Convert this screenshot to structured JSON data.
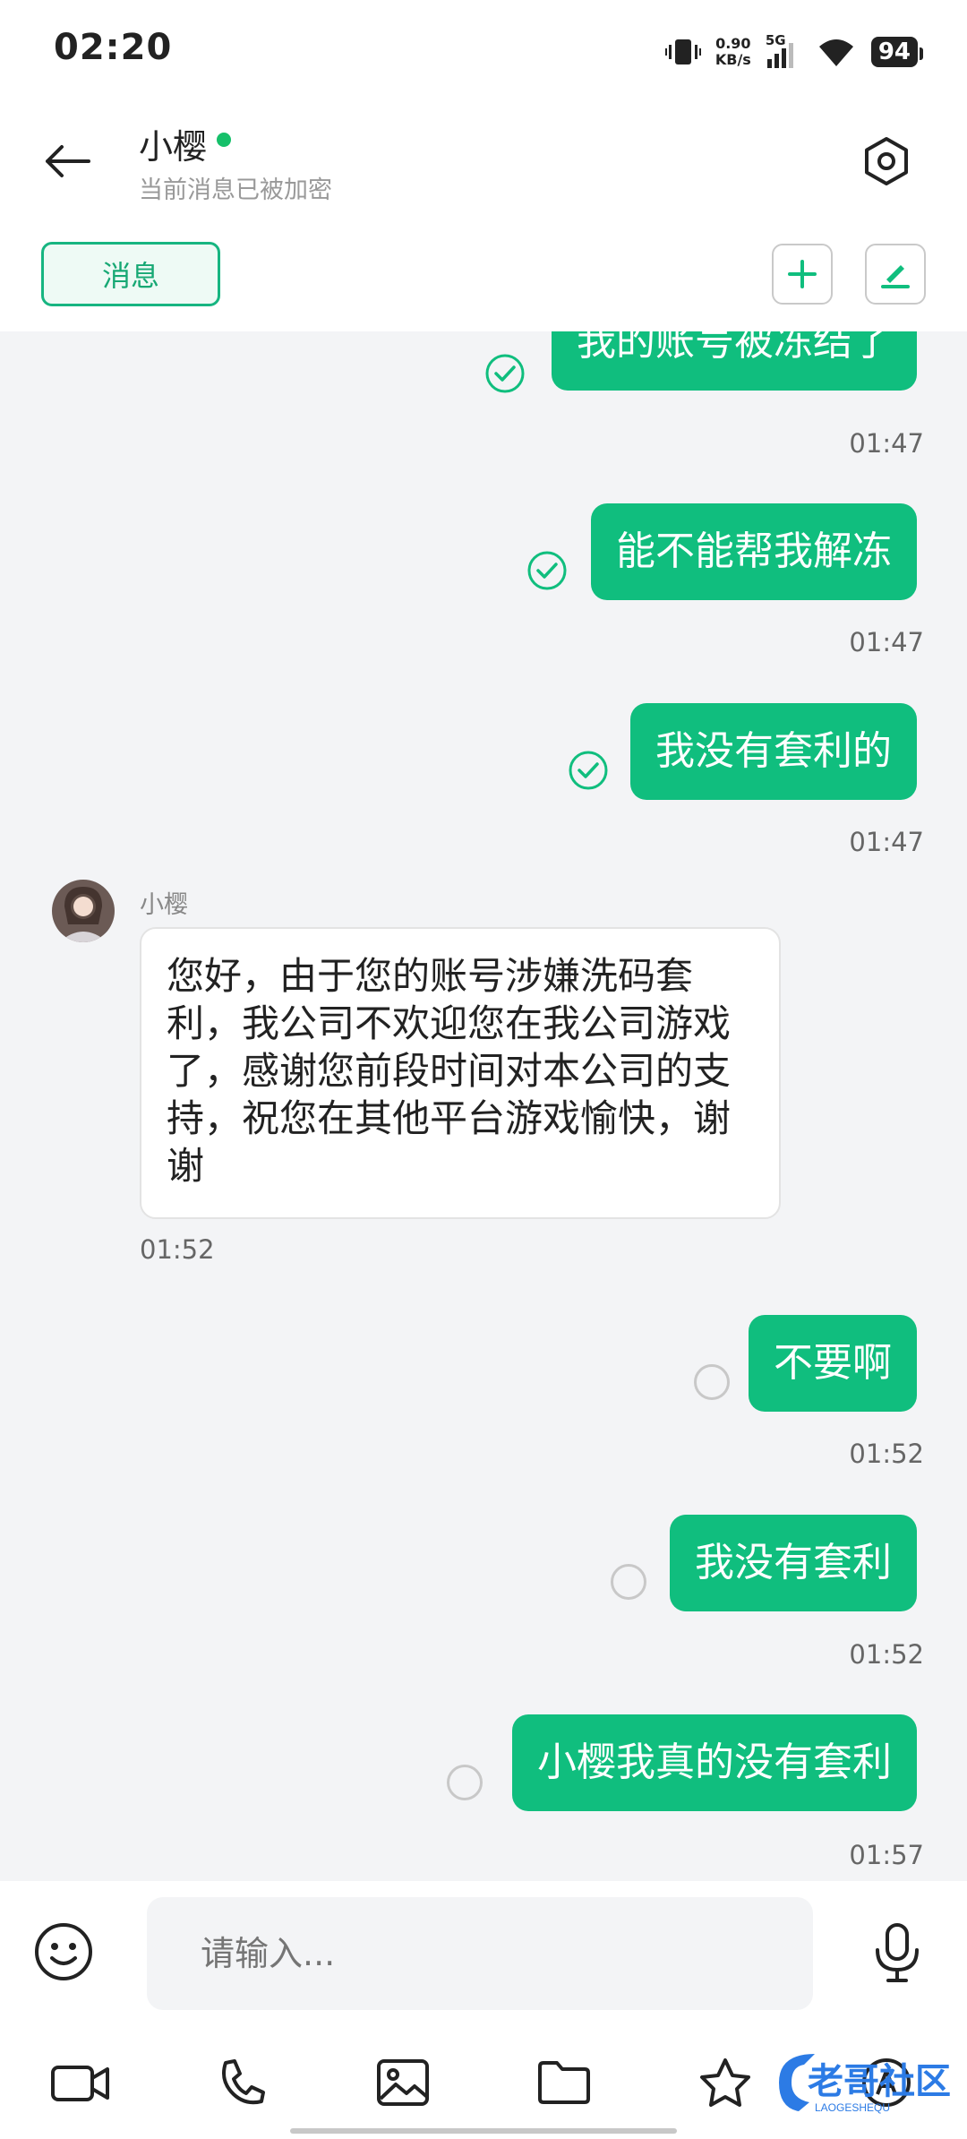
{
  "status_bar": {
    "time": "02:20",
    "net_speed_value": "0.90",
    "net_speed_unit": "KB/s",
    "network": "5G",
    "battery": "94"
  },
  "header": {
    "contact_name": "小樱",
    "encrypt_note": "当前消息已被加密",
    "tab_label": "消息",
    "accent_color": "#10be7e"
  },
  "messages": {
    "m1": {
      "text": "我的账号被冻结了",
      "time": "01:47"
    },
    "m2": {
      "text": "能不能帮我解冻",
      "time": "01:47"
    },
    "m3": {
      "text": "我没有套利的",
      "time": "01:47"
    },
    "incoming": {
      "sender": "小樱",
      "text": "您好，由于您的账号涉嫌洗码套利，我公司不欢迎您在我公司游戏了，感谢您前段时间对本公司的支持，祝您在其他平台游戏愉快，谢谢",
      "time": "01:52"
    },
    "m5": {
      "text": "不要啊",
      "time": "01:52"
    },
    "m6": {
      "text": "我没有套利",
      "time": "01:52"
    },
    "m7": {
      "text": "小樱我真的没有套利",
      "time": "01:57"
    }
  },
  "input": {
    "placeholder": "请输入..."
  },
  "watermark": {
    "text": "老哥社区",
    "sub": "LAOGESHEQU"
  }
}
